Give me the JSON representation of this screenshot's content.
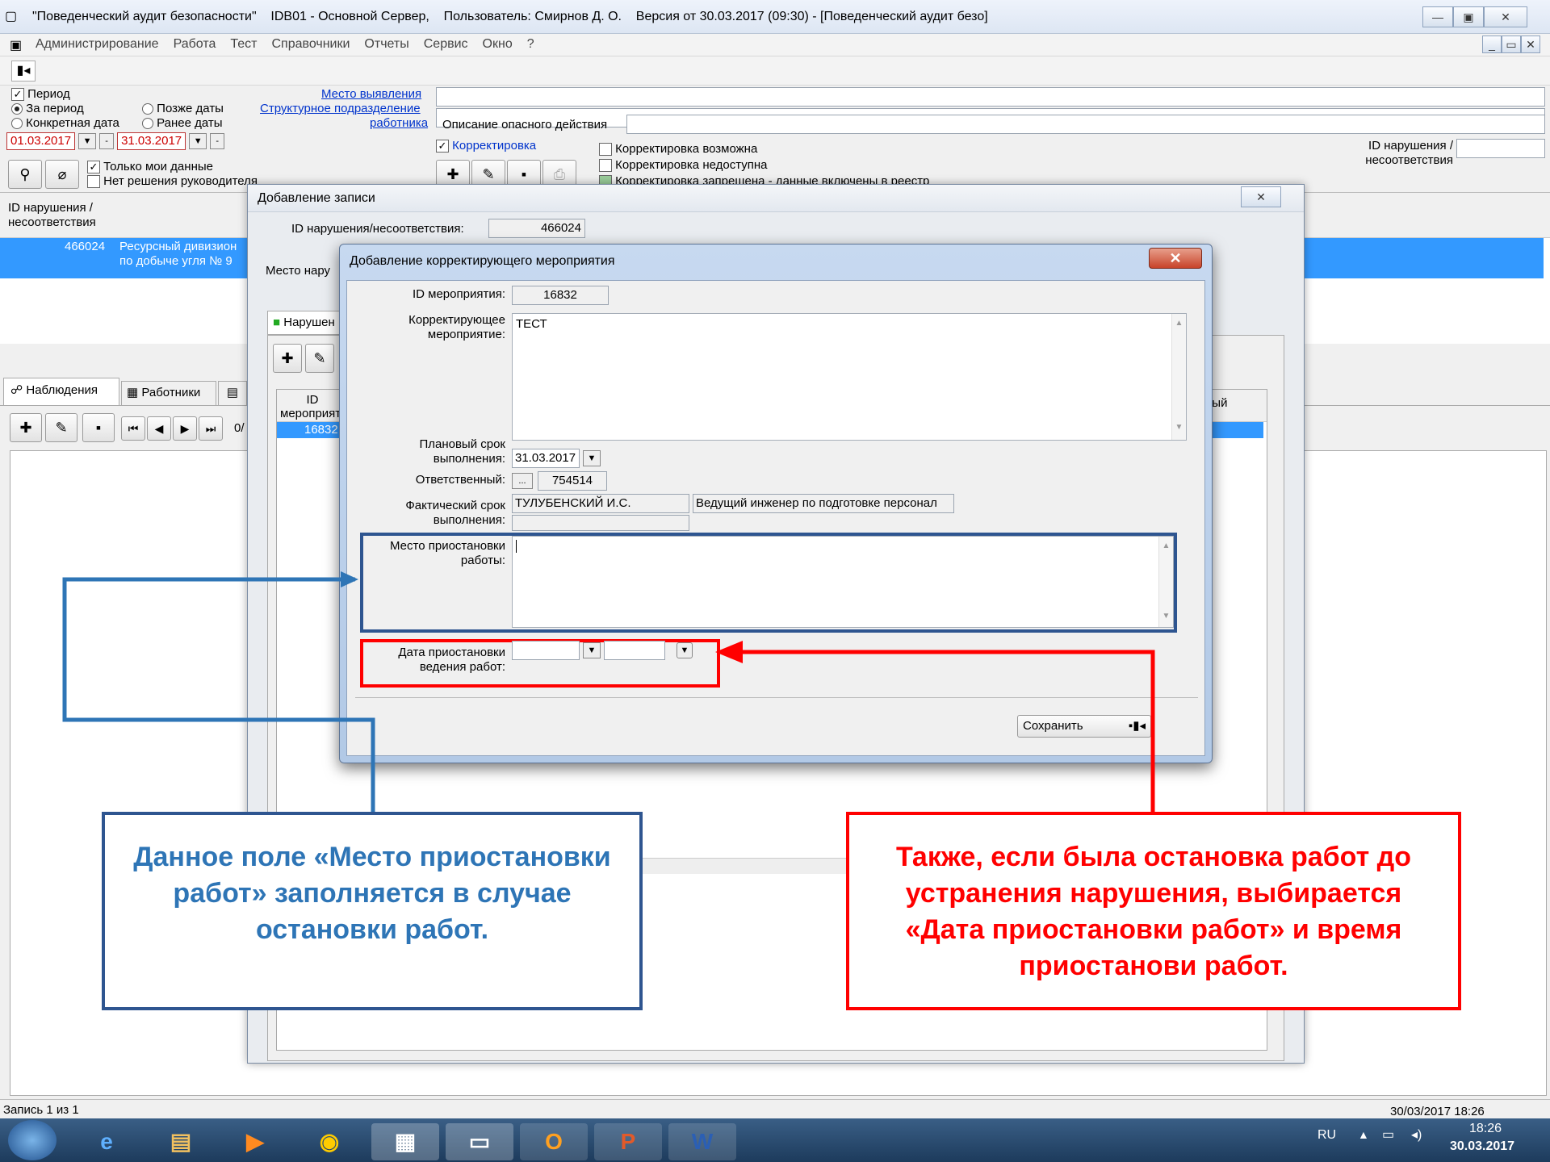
{
  "window": {
    "title": "\"Поведенческий аудит безопасности\"    IDB01 - Основной Сервер,    Пользователь: Смирнов Д. О.    Версия от 30.03.2017 (09:30) - [Поведенческий аудит безо]"
  },
  "menu": {
    "items": [
      "Администрирование",
      "Работа",
      "Тест",
      "Справочники",
      "Отчеты",
      "Сервис",
      "Окно",
      "?"
    ]
  },
  "filters": {
    "period_label": "Период",
    "radio_period": "За период",
    "radio_later": "Позже даты",
    "radio_specific": "Конкретная дата",
    "radio_earlier": "Ранее даты",
    "date_from": "01.03.2017",
    "date_to": "31.03.2017",
    "only_my_data": "Только мои данные",
    "no_decision": "Нет решения руководителя",
    "link_place": "Место выявления",
    "link_unit": "Структурное подразделение",
    "link_worker": "работника",
    "desc_label": "Описание опасного действия",
    "correction": "Корректировка",
    "corr_possible": "Корректировка возможна",
    "corr_unavailable": "Корректировка недоступна",
    "corr_forbidden": "Корректировка запрещена - данные включены в реестр",
    "id_violation_label": "ID нарушения / несоответствия"
  },
  "grid": {
    "col_id": "ID нарушения / несоответствия",
    "row_id": "466024",
    "row_text1": "Ресурсный дивизион",
    "row_text2": "по добыче угля № 9"
  },
  "tabs": {
    "observations": "Наблюдения",
    "workers": "Работники",
    "record_counter": "0/"
  },
  "dialog1": {
    "title": "Добавление записи",
    "id_label": "ID нарушения/несоответствия:",
    "id_value": "466024",
    "place_label": "Место нару",
    "tab_violations": "Нарушен",
    "col_id": "ID мероприятия",
    "row_id": "16832",
    "col_right": "ный"
  },
  "dialog2": {
    "title": "Добавление корректирующего мероприятия",
    "id_label": "ID мероприятия:",
    "id_value": "16832",
    "corr_label": "Корректирующее мероприятие:",
    "corr_value": "ТЕСТ",
    "plan_label": "Плановый срок выполнения:",
    "plan_value": "31.03.2017",
    "resp_label": "Ответственный:",
    "resp_code": "754514",
    "resp_name": "ТУЛУБЕНСКИЙ И.С.",
    "resp_position": "Ведущий инженер по подготовке персонал",
    "fact_label": "Фактический срок выполнения:",
    "place_label": "Место приостановки работы:",
    "date_label": "Дата приостановки ведения работ:",
    "save_label": "Сохранить"
  },
  "callouts": {
    "blue_text": "Данное поле «Место приостановки работ» заполняется в случае остановки работ.",
    "red_text": "Также, если была остановка работ до устранения нарушения, выбирается «Дата приостановки работ» и время приостанови работ.",
    "blue_color": "#2e75b6",
    "red_color": "#ff0000"
  },
  "status": {
    "record": "Запись  1  из  1",
    "datetime": "30/03/2017 18:26"
  },
  "taskbar": {
    "lang": "RU",
    "time": "18:26",
    "date": "30.03.2017"
  }
}
